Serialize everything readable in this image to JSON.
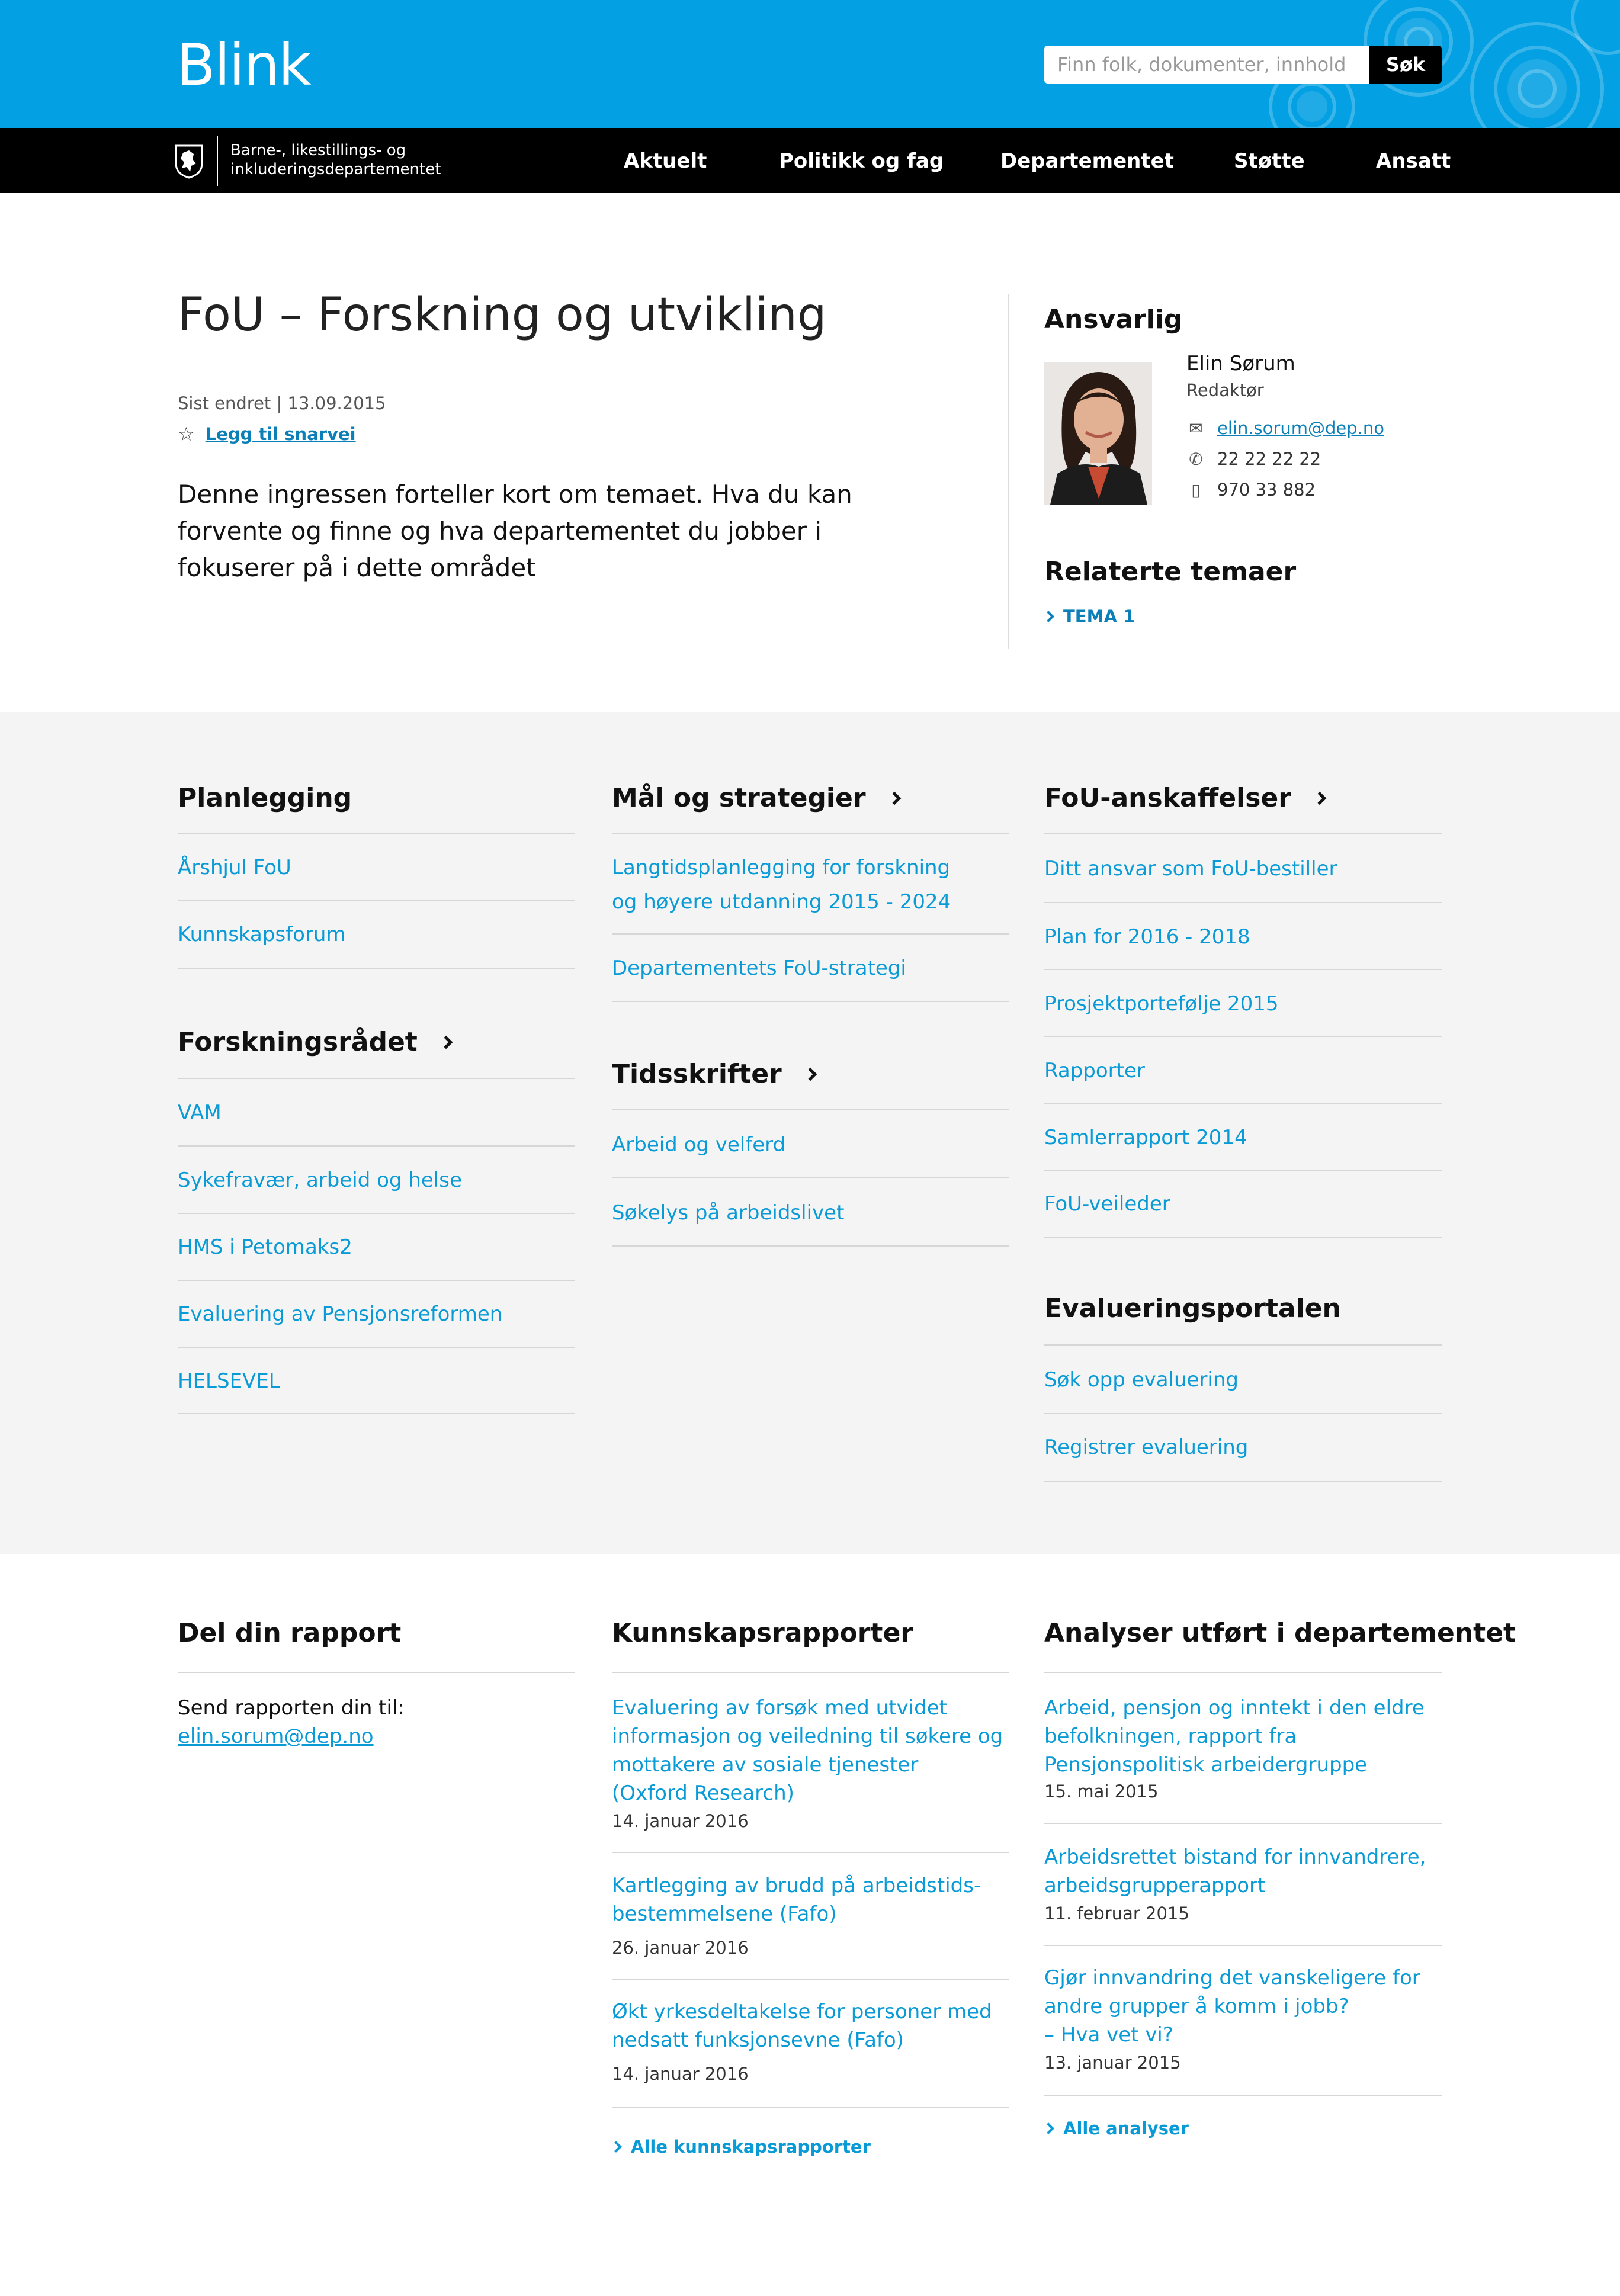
{
  "header": {
    "logo": "Blink",
    "search_placeholder": "Finn folk, dokumenter, innhold",
    "search_button": "Søk"
  },
  "nav": {
    "ministry_line1": "Barne-, likestillings- og",
    "ministry_line2": "inkluderingsdepartementet",
    "items": [
      "Aktuelt",
      "Politikk og fag",
      "Departementet",
      "Støtte",
      "Ansatt"
    ]
  },
  "article": {
    "title": "FoU – Forskning og utvikling",
    "updated_label": "Sist endret",
    "updated_date": "13.09.2015",
    "shortcut": "Legg til snarvei",
    "ingress_lines": [
      "Denne ingressen forteller kort om temaet. Hva du kan",
      "forvente og finne og hva departementet du jobber i",
      "fokuserer på i dette området"
    ]
  },
  "responsible": {
    "heading": "Ansvarlig",
    "name": "Elin Sørum",
    "role": "Redaktør",
    "email": "elin.sorum@dep.no",
    "phone": "22 22 22 22",
    "mobile": "970 33 882",
    "related_heading": "Relaterte temaer",
    "related_items": [
      "TEMA 1"
    ]
  },
  "columns": {
    "planlegging": {
      "title": "Planlegging",
      "links": [
        "Årshjul FoU",
        "Kunnskapsforum"
      ]
    },
    "forskningsradet": {
      "title": "Forskningsrådet",
      "links": [
        "VAM",
        "Sykefravær, arbeid og helse",
        "HMS i Petomaks2",
        "Evaluering av Pensjonsreformen",
        "HELSEVEL"
      ]
    },
    "mal": {
      "title": "Mål og strategier",
      "link1_line1": "Langtidsplanlegging for forskning",
      "link1_line2": "og høyere utdanning 2015 - 2024",
      "link2": "Departementets FoU-strategi"
    },
    "tidsskrifter": {
      "title": "Tidsskrifter",
      "links": [
        "Arbeid og velferd",
        "Søkelys på arbeidslivet"
      ]
    },
    "anskaffelser": {
      "title": "FoU-anskaffelser",
      "links": [
        "Ditt ansvar som FoU-bestiller",
        "Plan for 2016 - 2018",
        "Prosjektportefølje 2015",
        "Rapporter",
        "Samlerrapport 2014",
        "FoU-veileder"
      ]
    },
    "evalueringsportalen": {
      "title": "Evalueringsportalen",
      "links": [
        "Søk opp evaluering",
        "Registrer evaluering"
      ]
    }
  },
  "bottom": {
    "del": {
      "title": "Del din rapport",
      "text": "Send rapporten din til:",
      "email": "elin.sorum@dep.no"
    },
    "kunnskap": {
      "title": "Kunnskapsrapporter",
      "items": [
        {
          "lines": [
            "Evaluering av forsøk med utvidet",
            "informasjon og veiledning til søkere og",
            "mottakere av sosiale tjenester",
            "(Oxford Research)"
          ],
          "date": "14. januar 2016"
        },
        {
          "lines": [
            "Kartlegging av brudd på arbeidstids-",
            "bestemmelsene (Fafo)"
          ],
          "date": "26. januar 2016"
        },
        {
          "lines": [
            "Økt yrkesdeltakelse for personer med",
            "nedsatt funksjonsevne (Fafo)"
          ],
          "date": "14. januar 2016"
        }
      ],
      "more": "Alle kunnskapsrapporter"
    },
    "analyser": {
      "title": "Analyser utført i departementet",
      "items": [
        {
          "lines": [
            "Arbeid, pensjon og inntekt i den eldre",
            "befolkningen, rapport fra",
            "Pensjonspolitisk arbeidergruppe"
          ],
          "date": "15. mai 2015"
        },
        {
          "lines": [
            "Arbeidsrettet bistand for innvandrere,",
            "arbeidsgrupperapport"
          ],
          "date": "11. februar 2015"
        },
        {
          "lines": [
            "Gjør innvandring det vanskeligere for",
            "andre grupper å komm i jobb?",
            "– Hva vet vi?"
          ],
          "date": "13. januar 2015"
        }
      ],
      "more": "Alle analyser"
    }
  },
  "colors": {
    "brand_blue": "#03a0e3",
    "link_blue": "#0a9bd6",
    "nav_black": "#000000",
    "section_grey": "#f4f4f4"
  }
}
